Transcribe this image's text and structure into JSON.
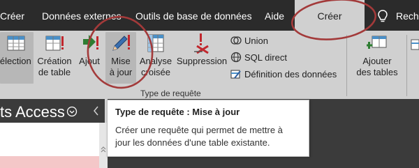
{
  "tabs": [
    {
      "label": "Créer"
    },
    {
      "label": "Données externes"
    },
    {
      "label": "Outils de base de données"
    },
    {
      "label": "Aide"
    },
    {
      "label": "Créer"
    },
    {
      "label": "Reche"
    }
  ],
  "ribbon": {
    "buttons": [
      {
        "label": "Sélection"
      },
      {
        "label_line1": "Création",
        "label_line2": "de table"
      },
      {
        "label": "Ajout"
      },
      {
        "label_line1": "Mise",
        "label_line2": "à jour"
      },
      {
        "label_line1": "Analyse",
        "label_line2": "croisée"
      },
      {
        "label": "Suppression"
      },
      {
        "label_line1": "Ajouter",
        "label_line2": "des tables"
      }
    ],
    "small_items": [
      {
        "label": "Union"
      },
      {
        "label": "SQL direct"
      },
      {
        "label": "Définition des données"
      }
    ],
    "group_label": "Type de requête"
  },
  "nav_pane": {
    "title": "ts Access"
  },
  "tooltip": {
    "title": "Type de requête : Mise à jour",
    "description": "Créer une requête qui permet de mettre à jour les données d'une table existante."
  },
  "colors": {
    "tab_bar": "#2b2b2b",
    "ribbon": "#d0d0d0",
    "annotation": "#a33a3a",
    "accent_red": "#c1272d"
  }
}
